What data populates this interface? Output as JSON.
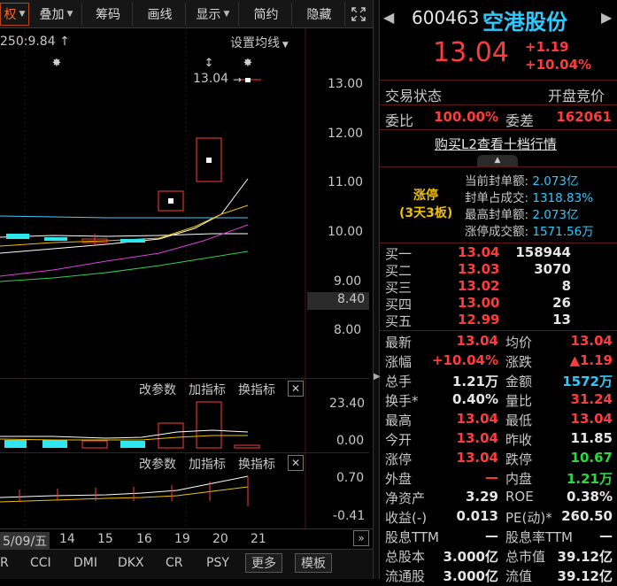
{
  "toolbar": {
    "first": "权",
    "items": [
      {
        "label": "叠加",
        "dropdown": true
      },
      {
        "label": "筹码",
        "dropdown": false
      },
      {
        "label": "画线",
        "dropdown": false
      },
      {
        "label": "显示",
        "dropdown": true
      },
      {
        "label": "简约",
        "dropdown": false
      },
      {
        "label": "隐藏",
        "dropdown": false
      }
    ],
    "expand_icon": "expand-icon"
  },
  "main": {
    "ma_label": "250:9.84",
    "ma_arrow": "↑",
    "set_ma": "设置均线",
    "last_price_label": "13.04",
    "price_axis": [
      "13.00",
      "12.00",
      "11.00",
      "10.00",
      "9.00",
      "8.40",
      "8.00"
    ],
    "current_price_box": "8.40"
  },
  "vol": {
    "btn1": "改参数",
    "btn2": "加指标",
    "btn3": "换指标",
    "axis_top": "23.40",
    "axis_bottom": "0.00"
  },
  "ind": {
    "btn1": "改参数",
    "btn2": "加指标",
    "btn3": "换指标",
    "axis_top": "0.70",
    "axis_bottom": "-0.41"
  },
  "dates": {
    "first": "5/09/五",
    "items": [
      "14",
      "15",
      "16",
      "19",
      "20",
      "21"
    ]
  },
  "bottom_tabs": [
    "R",
    "CCI",
    "DMI",
    "DKX",
    "CR",
    "PSY"
  ],
  "bottom_more": "更多",
  "bottom_template": "模板",
  "stock": {
    "code": "600463",
    "name": "空港股份",
    "price": "13.04",
    "change": "+1.19",
    "change_pct": "+10.04%"
  },
  "status": {
    "label": "交易状态",
    "value": "开盘竞价"
  },
  "weibi": {
    "label": "委比",
    "value": "100.00%",
    "label2": "委差",
    "value2": "162061"
  },
  "l2_link": "购买L2查看十档行情",
  "limit": {
    "title": "涨停",
    "subtitle": "(3天3板)",
    "rows": [
      {
        "k": "当前封单额:",
        "v": "2.073亿"
      },
      {
        "k": "封单占成交:",
        "v": "1318.83%"
      },
      {
        "k": "最高封单额:",
        "v": "2.073亿"
      },
      {
        "k": "涨停成交额:",
        "v": "1571.56万"
      }
    ]
  },
  "bids": [
    {
      "label": "买一",
      "price": "13.04",
      "vol": "158944"
    },
    {
      "label": "买二",
      "price": "13.03",
      "vol": "3070"
    },
    {
      "label": "买三",
      "price": "13.02",
      "vol": "8"
    },
    {
      "label": "买四",
      "price": "13.00",
      "vol": "26"
    },
    {
      "label": "买五",
      "price": "12.99",
      "vol": "13"
    }
  ],
  "quote": [
    {
      "l1": "最新",
      "v1": "13.04",
      "c1": "r",
      "l2": "均价",
      "v2": "13.04",
      "c2": "r"
    },
    {
      "l1": "涨幅",
      "v1": "+10.04%",
      "c1": "r",
      "l2": "涨跌",
      "v2": "▲1.19",
      "c2": "r"
    },
    {
      "l1": "总手",
      "v1": "1.21万",
      "c1": "w",
      "l2": "金额",
      "v2": "1572万",
      "c2": "c"
    },
    {
      "l1": "换手*",
      "v1": "0.40%",
      "c1": "w",
      "l2": "量比",
      "v2": "31.24",
      "c2": "r"
    },
    {
      "l1": "最高",
      "v1": "13.04",
      "c1": "r",
      "l2": "最低",
      "v2": "13.04",
      "c2": "r"
    },
    {
      "l1": "今开",
      "v1": "13.04",
      "c1": "r",
      "l2": "昨收",
      "v2": "11.85",
      "c2": "w"
    },
    {
      "l1": "涨停",
      "v1": "13.04",
      "c1": "r",
      "l2": "跌停",
      "v2": "10.67",
      "c2": "g"
    },
    {
      "l1": "外盘",
      "v1": "—",
      "c1": "r",
      "l2": "内盘",
      "v2": "1.21万",
      "c2": "g"
    },
    {
      "l1": "净资产",
      "v1": "3.29",
      "c1": "w",
      "l2": "ROE",
      "v2": "0.38%",
      "c2": "w"
    },
    {
      "l1": "收益(-)",
      "v1": "0.013",
      "c1": "w",
      "l2": "PE(动)*",
      "v2": "260.50",
      "c2": "w"
    },
    {
      "l1": "股息TTM",
      "v1": "—",
      "c1": "w",
      "l2": "股息率TTM",
      "v2": "—",
      "c2": "w"
    },
    {
      "l1": "总股本",
      "v1": "3.000亿",
      "c1": "w",
      "l2": "总市值",
      "v2": "39.12亿",
      "c2": "w"
    },
    {
      "l1": "流通股",
      "v1": "3.000亿",
      "c1": "w",
      "l2": "流值",
      "v2": "39.12亿",
      "c2": "w"
    }
  ]
}
